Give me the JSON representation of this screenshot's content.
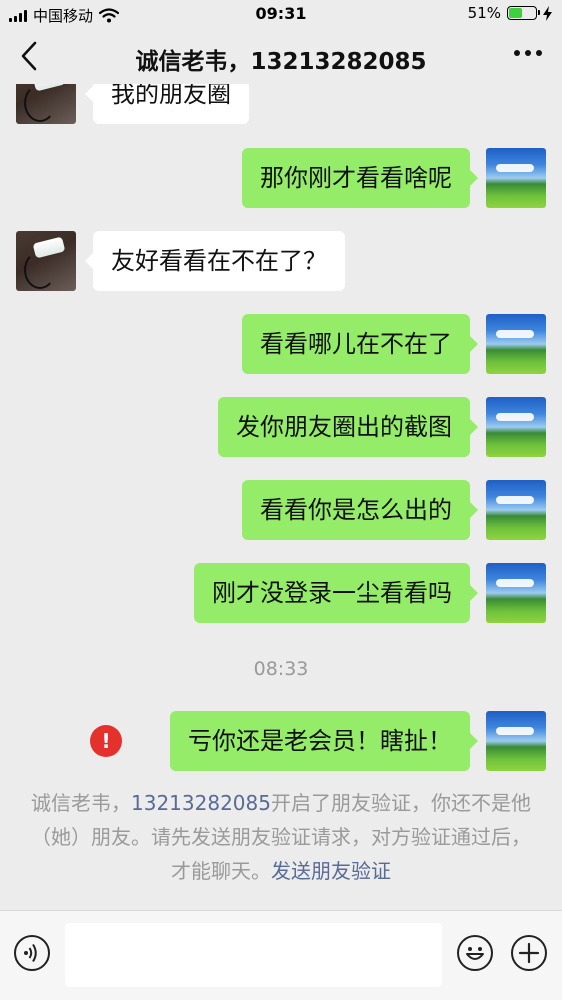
{
  "status_bar": {
    "carrier": "中国移动",
    "time": "09:31",
    "battery_percent": "51%",
    "battery_level": 0.51,
    "icons": [
      "signal-icon",
      "wifi-icon",
      "battery-icon",
      "charging-icon"
    ]
  },
  "header": {
    "title": "诚信老韦，13213282085",
    "back_icon": "chevron-left-icon",
    "more_icon": "more-icon"
  },
  "messages": [
    {
      "from": "friend",
      "text": "我的朋友圈"
    },
    {
      "from": "me",
      "text": "那你刚才看看啥呢"
    },
    {
      "from": "friend",
      "text": "友好看看在不在了？"
    },
    {
      "from": "me",
      "text": "看看哪儿在不在了"
    },
    {
      "from": "me",
      "text": "发你朋友圈出的截图"
    },
    {
      "from": "me",
      "text": "看看你是怎么出的"
    },
    {
      "from": "me",
      "text": "刚才没登录一尘看看吗"
    },
    {
      "from": "me",
      "text": "亏你还是老会员！瞎扯！",
      "failed": true
    }
  ],
  "timestamp": "08:33",
  "error_mark": "!",
  "system_notice": {
    "prefix": "诚信老韦，",
    "phone": "13213282085",
    "body": "开启了朋友验证，你还不是他（她）朋友。请先发送朋友验证请求，对方验证通过后，才能聊天。",
    "link": "发送朋友验证"
  },
  "input_bar": {
    "placeholder": "",
    "voice_icon": "voice-icon",
    "emoji_icon": "emoji-icon",
    "plus_icon": "plus-icon"
  },
  "colors": {
    "background": "#ececec",
    "outgoing_bubble": "#95ec69",
    "incoming_bubble": "#ffffff",
    "link": "#576b95",
    "error": "#e5312b"
  }
}
